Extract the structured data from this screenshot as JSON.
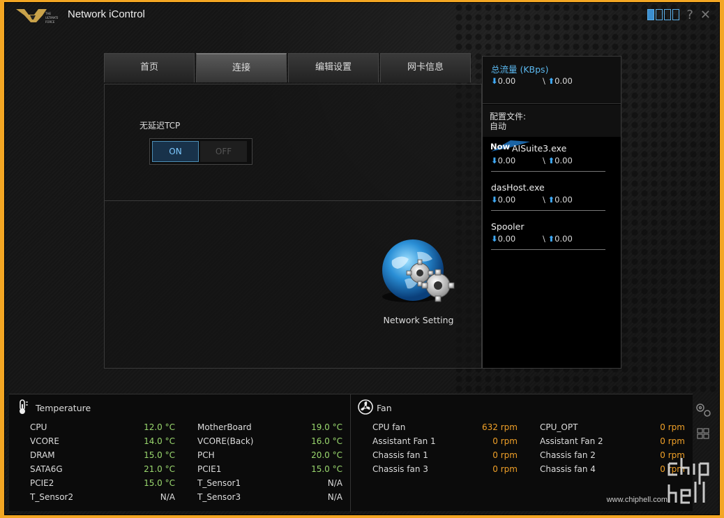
{
  "app": {
    "title": "Network iControl",
    "logo_alt": "THE ULTIMATE FORCE"
  },
  "window_controls": {
    "help": "?",
    "close": "✕"
  },
  "tabs": [
    {
      "label": "首页",
      "active": false
    },
    {
      "label": "连接",
      "active": true
    },
    {
      "label": "编辑设置",
      "active": false
    },
    {
      "label": "网卡信息",
      "active": false
    }
  ],
  "main": {
    "tcp_label": "无延迟TCP",
    "toggle_on": "ON",
    "toggle_off": "OFF",
    "network_setting_label": "Network Setting"
  },
  "traffic": {
    "total_label": "总流量 (KBps)",
    "total_down": "0.00",
    "total_up": "0.00",
    "profile_label": "配置文件:",
    "profile_value": "自动",
    "now_badge": "Now",
    "processes": [
      {
        "name": "AISuite3.exe",
        "down": "0.00",
        "up": "0.00"
      },
      {
        "name": "dasHost.exe",
        "down": "0.00",
        "up": "0.00"
      },
      {
        "name": "Spooler",
        "down": "0.00",
        "up": "0.00"
      }
    ]
  },
  "temperature": {
    "title": "Temperature",
    "left": [
      {
        "name": "CPU",
        "value": "12.0 °C"
      },
      {
        "name": "VCORE",
        "value": "14.0 °C"
      },
      {
        "name": "DRAM",
        "value": "15.0 °C"
      },
      {
        "name": "SATA6G",
        "value": "21.0 °C"
      },
      {
        "name": "PCIE2",
        "value": "15.0 °C"
      },
      {
        "name": "T_Sensor2",
        "value": "N/A"
      }
    ],
    "right": [
      {
        "name": "MotherBoard",
        "value": "19.0 °C"
      },
      {
        "name": "VCORE(Back)",
        "value": "16.0 °C"
      },
      {
        "name": "PCH",
        "value": "20.0 °C"
      },
      {
        "name": "PCIE1",
        "value": "15.0 °C"
      },
      {
        "name": "T_Sensor1",
        "value": "N/A"
      },
      {
        "name": "T_Sensor3",
        "value": "N/A"
      }
    ]
  },
  "fan": {
    "title": "Fan",
    "left": [
      {
        "name": "CPU fan",
        "value": "632  rpm"
      },
      {
        "name": "Assistant Fan 1",
        "value": "0  rpm"
      },
      {
        "name": "Chassis fan 1",
        "value": "0  rpm"
      },
      {
        "name": "Chassis fan 3",
        "value": "0  rpm"
      }
    ],
    "right": [
      {
        "name": "CPU_OPT",
        "value": "0  rpm"
      },
      {
        "name": "Assistant Fan 2",
        "value": "0  rpm"
      },
      {
        "name": "Chassis fan 2",
        "value": "0  rpm"
      },
      {
        "name": "Chassis fan 4",
        "value": "0  rpm"
      }
    ]
  },
  "watermark": {
    "text": "www.chiphell.com"
  },
  "colors": {
    "accent_blue": "#3fa9f5",
    "temp_green": "#9ad86e",
    "fan_orange": "#f0a028",
    "frame": "#f3a623"
  }
}
